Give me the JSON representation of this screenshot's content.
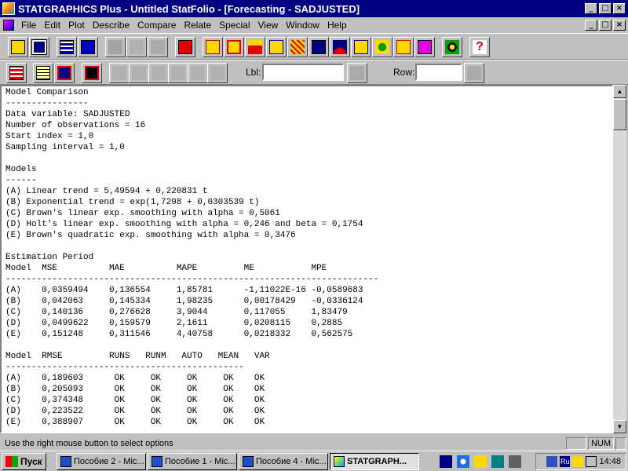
{
  "window": {
    "title": "STATGRAPHICS Plus - Untitled StatFolio - [Forecasting - SADJUSTED]",
    "minimize": "_",
    "maximize": "□",
    "close": "×"
  },
  "menu": {
    "items": [
      "File",
      "Edit",
      "Plot",
      "Describe",
      "Compare",
      "Relate",
      "Special",
      "View",
      "Window",
      "Help"
    ]
  },
  "toolbar": {
    "lbl_label": "Lbl:",
    "lbl_value": "",
    "row_label": "Row:",
    "row_value": ""
  },
  "output_lines": [
    "Model Comparison",
    "----------------",
    "Data variable: SADJUSTED",
    "Number of observations = 16",
    "Start index = 1,0",
    "Sampling interval = 1,0",
    "",
    "Models",
    "------",
    "(A) Linear trend = 5,49594 + 0,220831 t",
    "(B) Exponential trend = exp(1,7298 + 0,0303539 t)",
    "(C) Brown's linear exp. smoothing with alpha = 0,5061",
    "(D) Holt's linear exp. smoothing with alpha = 0,246 and beta = 0,1754",
    "(E) Brown's quadratic exp. smoothing with alpha = 0,3476",
    "",
    "Estimation Period",
    "Model  MSE          MAE          MAPE         ME           MPE",
    "------------------------------------------------------------------------",
    "(A)    0,0359494    0,136554     1,85781      -1,11022E-16 -0,0589683",
    "(B)    0,042063     0,145334     1,98235      0,00178429   -0,0336124",
    "(C)    0,140136     0,276628     3,9044       0,117055     1,83479",
    "(D)    0,0499622    0,159579     2,1611       0,0208115    0,2885",
    "(E)    0,151248     0,311546     4,40758      0,0218332    0,562575",
    "",
    "Model  RMSE         RUNS   RUNM   AUTO   MEAN   VAR",
    "----------------------------------------------",
    "(A)    0,189603      OK     OK     OK     OK    OK",
    "(B)    0,205093      OK     OK     OK     OK    OK",
    "(C)    0,374348      OK     OK     OK     OK    OK",
    "(D)    0,223522      OK     OK     OK     OK    OK",
    "(E)    0,388907      OK     OK     OK     OK    OK"
  ],
  "status": {
    "message": "Use the right mouse button to select options",
    "num": "NUM"
  },
  "taskbar": {
    "start": "Пуск",
    "tasks": [
      "Пособие 2 - Mic...",
      "Пособие 1 - Mic...",
      "Пособие 4 - Mic...",
      "STATGRAPH..."
    ],
    "lang": "Ru",
    "clock": "14:48"
  },
  "colors": {
    "titlebar": "#000080",
    "face": "#c0c0c0"
  }
}
